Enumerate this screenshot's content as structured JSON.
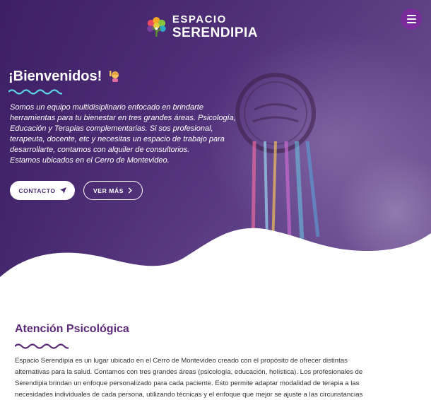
{
  "header": {
    "logo_line1": "ESPACIO",
    "logo_line2": "SERENDIPIA",
    "menu_icon": "hamburger-icon"
  },
  "hero": {
    "title": "¡Bienvenidos!",
    "title_emoji": "woman-raising-hand-icon",
    "intro_lines": [
      "Somos un equipo multidisiplinario enfocado en brindarte",
      "herramientas para tu bienestar en tres grandes áreas. Psicología,",
      "Educación y Terapias complementarias. Si sos profesional,",
      "terapeuta, docente, etc y necesitas un espacio de trabajo para",
      "desarrollarte, contamos con alquiler de consultorios.",
      "Estamos ubicados en el Cerro de Montevideo."
    ],
    "contact_label": "CONTACTO",
    "contact_icon": "send-icon",
    "more_label": "VER MÁS",
    "more_icon": "chevron-right-icon"
  },
  "section": {
    "title": "Atención Psicológica",
    "body_lines": [
      "Espacio Serendipia es un lugar ubicado en el Cerro de Montevideo creado con el propósito de ofrecer distintas",
      "alternativas para la salud. Contamos con tres grandes áreas (psicología, educación, holística). Los profesionales de",
      "Serendipia brindan un enfoque personalizado para cada paciente. Esto permite adaptar modalidad de terapia a las",
      "necesidades individuales de cada persona, utilizando técnicas y el enfoque que mejor se ajuste a las circunstancias"
    ]
  },
  "colors": {
    "brand_purple": "#5b2a78",
    "menu_button": "#7a2d9a",
    "wave_accent": "#5cd6e6"
  }
}
